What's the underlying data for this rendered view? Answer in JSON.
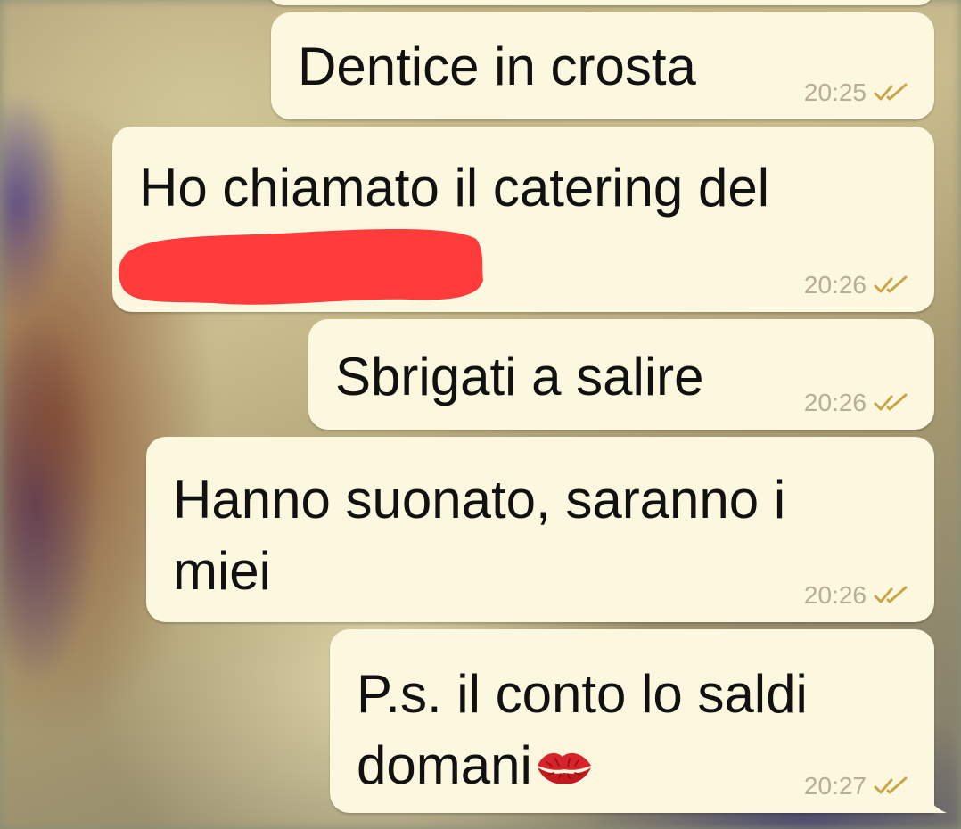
{
  "colors": {
    "bubble_bg": "#fcf7df",
    "text": "#111111",
    "timestamp": "#b9ad92",
    "read_ticks": "#c8a548",
    "redaction": "#ff3b3b"
  },
  "messages": [
    {
      "text": "Dentice in crosta",
      "time": "20:25",
      "status": "read-ticks-icon"
    },
    {
      "text": "Ho chiamato il catering del",
      "time": "20:26",
      "status": "read-ticks-icon",
      "redacted": true
    },
    {
      "text": "Sbrigati a salire",
      "time": "20:26",
      "status": "read-ticks-icon"
    },
    {
      "line1": "Hanno suonato, saranno i",
      "line2": "miei",
      "time": "20:26",
      "status": "read-ticks-icon"
    },
    {
      "line1": "P.s. il conto lo saldi",
      "line2": "domani",
      "emoji": "kiss-mark-icon",
      "time": "20:27",
      "status": "read-ticks-icon"
    }
  ]
}
